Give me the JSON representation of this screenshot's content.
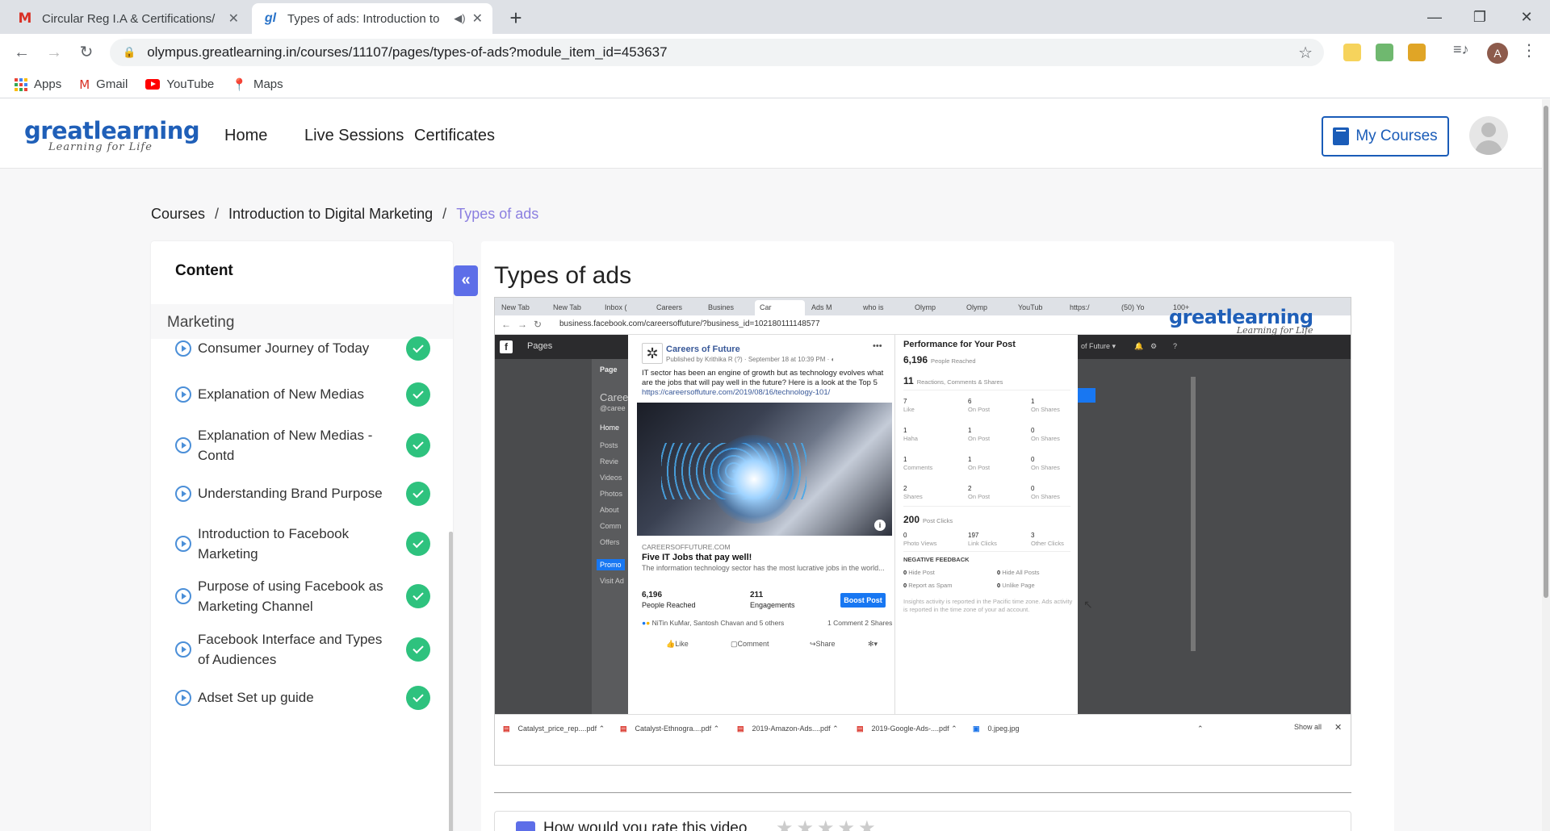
{
  "browser": {
    "tabs": [
      {
        "title": "Circular Reg I.A & Certifications/",
        "favicon": "gmail-icon",
        "active": false
      },
      {
        "title": "Types of ads: Introduction to",
        "favicon": "greatlearning-icon",
        "active": true
      }
    ],
    "url": "olympus.greatlearning.in/courses/11107/pages/types-of-ads?module_item_id=453637",
    "profile_initial": "A",
    "bookmarks": [
      {
        "label": "Apps",
        "icon": "apps-icon"
      },
      {
        "label": "Gmail",
        "icon": "gmail-icon"
      },
      {
        "label": "YouTube",
        "icon": "youtube-icon"
      },
      {
        "label": "Maps",
        "icon": "maps-icon"
      }
    ]
  },
  "site": {
    "logo_main": "greatlearning",
    "logo_tagline": "Learning for Life",
    "nav": [
      "Home",
      "Live Sessions",
      "Certificates"
    ],
    "my_courses_label": "My Courses"
  },
  "breadcrumb": [
    "Courses",
    "Introduction to Digital Marketing",
    "Types of ads"
  ],
  "sidebar": {
    "title": "Content",
    "module": "Marketing",
    "items": [
      {
        "label": "Consumer Journey of Today",
        "completed": true
      },
      {
        "label": "Explanation of New Medias",
        "completed": true
      },
      {
        "label": "Explanation of New Medias - Contd",
        "completed": true
      },
      {
        "label": "Understanding Brand Purpose",
        "completed": true
      },
      {
        "label": "Introduction to Facebook Marketing",
        "completed": true
      },
      {
        "label": "Purpose of using Facebook as Marketing Channel",
        "completed": true
      },
      {
        "label": "Facebook Interface and Types of Audiences",
        "completed": true
      },
      {
        "label": "Adset Set up guide",
        "completed": true
      }
    ],
    "collapse_glyph": "«"
  },
  "main": {
    "title": "Types of ads",
    "rate_question": "How would you rate this video",
    "stars": "★★★★★"
  },
  "video_frame": {
    "tabs": [
      "New Tab",
      "New Tab",
      "Inbox (",
      "Careers",
      "Busines",
      "Car",
      "Ads M",
      "who is",
      "Olymp",
      "Olymp",
      "YouTub",
      "https:/",
      "(50) Yo",
      "100+"
    ],
    "url": "business.facebook.com/careersoffuture/?business_id=102180111148577",
    "watermark_main": "greatlearning",
    "watermark_tag": "Learning for Life",
    "fb_pages_label": "Pages",
    "fb_side": [
      "Page",
      "Caree",
      "@caree",
      "Home",
      "Posts",
      "Revie",
      "Videos",
      "Photos",
      "About",
      "Comm",
      "Offers",
      "Promo",
      "Visit Ad"
    ],
    "post": {
      "page_name": "Careers of Future",
      "meta": "Published by Krithika R (?) · September 18 at 10:39 PM · ◐",
      "text": "IT sector has been an engine of growth but as technology evolves what are the jobs that will pay well in the future? Here is a look at the Top 5",
      "link": "https://careersoffuture.com/2019/08/16/technology-101/",
      "domain": "CAREERSOFFUTURE.COM",
      "headline": "Five IT Jobs that pay well!",
      "description": "The information technology sector has the most lucrative jobs in the world...",
      "reached_value": "6,196",
      "reached_label": "People Reached",
      "engagements_value": "211",
      "engagements_label": "Engagements",
      "boost_label": "Boost Post",
      "reactors": "NiTin KuMar, Santosh Chavan and 5 others",
      "comments_shares": "1 Comment  2 Shares",
      "actions": [
        "Like",
        "Comment",
        "Share"
      ]
    },
    "performance": {
      "title": "Performance for Your Post",
      "people_reached": "6,196",
      "people_reached_label": "People Reached",
      "reactions": "11",
      "reactions_label": "Reactions, Comments & Shares",
      "rows": [
        [
          {
            "v": "7",
            "l": "Like"
          },
          {
            "v": "6",
            "l": "On Post"
          },
          {
            "v": "1",
            "l": "On Shares"
          }
        ],
        [
          {
            "v": "1",
            "l": "Haha"
          },
          {
            "v": "1",
            "l": "On Post"
          },
          {
            "v": "0",
            "l": "On Shares"
          }
        ],
        [
          {
            "v": "1",
            "l": "Comments"
          },
          {
            "v": "1",
            "l": "On Post"
          },
          {
            "v": "0",
            "l": "On Shares"
          }
        ],
        [
          {
            "v": "2",
            "l": "Shares"
          },
          {
            "v": "2",
            "l": "On Post"
          },
          {
            "v": "0",
            "l": "On Shares"
          }
        ]
      ],
      "post_clicks": "200",
      "post_clicks_label": "Post Clicks",
      "clicks": [
        {
          "v": "0",
          "l": "Photo Views"
        },
        {
          "v": "197",
          "l": "Link Clicks"
        },
        {
          "v": "3",
          "l": "Other Clicks"
        }
      ],
      "negative_head": "NEGATIVE FEEDBACK",
      "negative": [
        {
          "v": "0",
          "l": "Hide Post"
        },
        {
          "v": "0",
          "l": "Hide All Posts"
        },
        {
          "v": "0",
          "l": "Report as Spam"
        },
        {
          "v": "0",
          "l": "Unlike Page"
        }
      ],
      "note": "Insights activity is reported in the Pacific time zone. Ads activity is reported in the time zone of your ad account."
    },
    "right_top": [
      "of Future ▾"
    ],
    "downloads": [
      "Catalyst_price_rep....pdf",
      "Catalyst-Ethnogra....pdf",
      "2019-Amazon-Ads....pdf",
      "2019-Google-Ads-....pdf",
      "0.jpeg.jpg"
    ],
    "show_all": "Show all"
  },
  "colors": {
    "brand_blue": "#1a5cb8",
    "accent_purple": "#8b7fe0",
    "collapse_btn": "#5d6ee8",
    "check_green": "#2ec27e"
  }
}
